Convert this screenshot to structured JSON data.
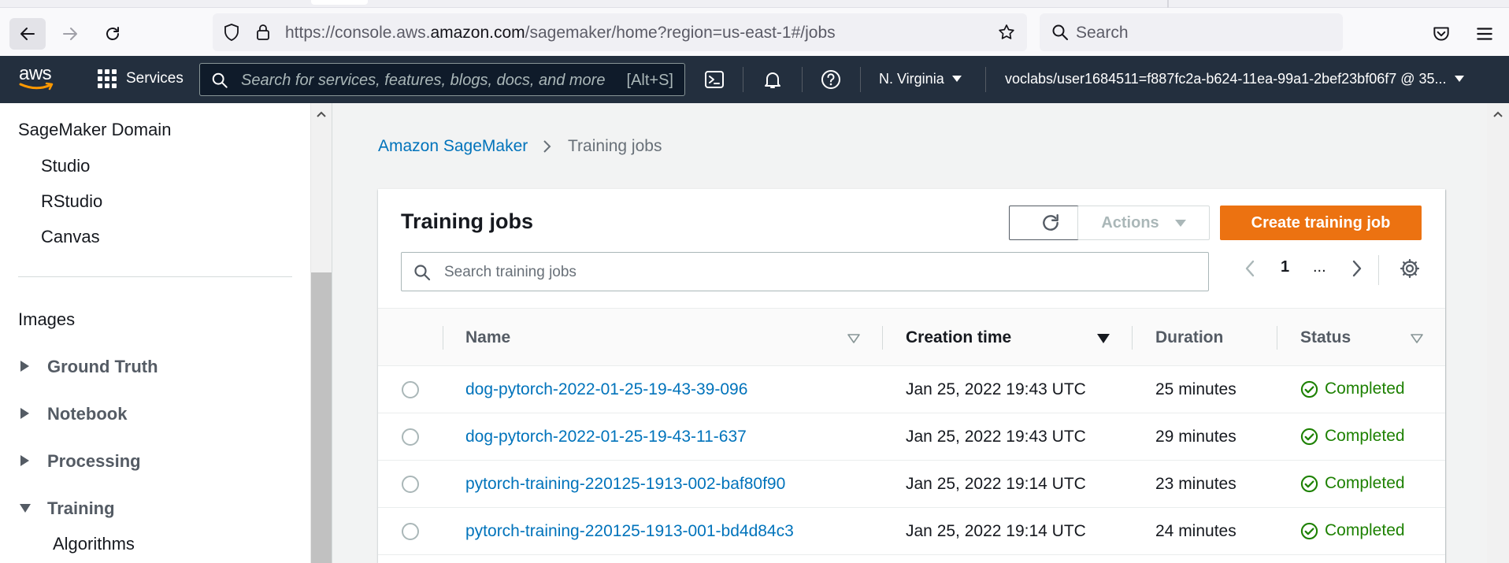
{
  "browser": {
    "url_prefix": "https://console.aws.",
    "url_domain": "amazon.com",
    "url_suffix": "/sagemaker/home?region=us-east-1#/jobs",
    "search_placeholder": "Search"
  },
  "aws_nav": {
    "logo": "aws",
    "services_label": "Services",
    "search_placeholder": "Search for services, features, blogs, docs, and more",
    "search_shortcut": "[Alt+S]",
    "region": "N. Virginia",
    "account": "voclabs/user1684511=f887fc2a-b624-11ea-99a1-2bef23bf06f7 @ 35..."
  },
  "sidebar": {
    "domain_header": "SageMaker Domain",
    "domain_items": [
      "Studio",
      "RStudio",
      "Canvas"
    ],
    "images_label": "Images",
    "sections": [
      "Ground Truth",
      "Notebook",
      "Processing",
      "Training"
    ],
    "training_sub": "Algorithms"
  },
  "breadcrumb": {
    "root": "Amazon SageMaker",
    "current": "Training jobs"
  },
  "panel": {
    "title": "Training jobs",
    "actions_label": "Actions",
    "create_label": "Create training job",
    "search_placeholder": "Search training jobs",
    "page_number": "1",
    "page_ellipsis": "..."
  },
  "table": {
    "columns": [
      "Name",
      "Creation time",
      "Duration",
      "Status"
    ],
    "rows": [
      {
        "name": "dog-pytorch-2022-01-25-19-43-39-096",
        "creation_time": "Jan 25, 2022 19:43 UTC",
        "duration": "25 minutes",
        "status": "Completed"
      },
      {
        "name": "dog-pytorch-2022-01-25-19-43-11-637",
        "creation_time": "Jan 25, 2022 19:43 UTC",
        "duration": "29 minutes",
        "status": "Completed"
      },
      {
        "name": "pytorch-training-220125-1913-002-baf80f90",
        "creation_time": "Jan 25, 2022 19:14 UTC",
        "duration": "23 minutes",
        "status": "Completed"
      },
      {
        "name": "pytorch-training-220125-1913-001-bd4d84c3",
        "creation_time": "Jan 25, 2022 19:14 UTC",
        "duration": "24 minutes",
        "status": "Completed"
      }
    ]
  },
  "colors": {
    "aws_nav_bg": "#232f3e",
    "link": "#0073bb",
    "primary_button": "#ec7211",
    "success": "#1d8102"
  }
}
